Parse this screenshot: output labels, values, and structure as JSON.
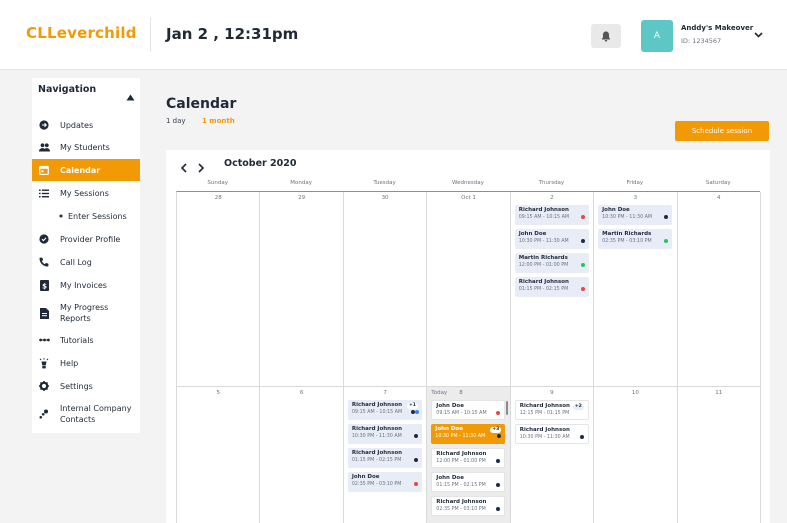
{
  "header": {
    "logo": "CLLeverchild",
    "datetime": "Jan 2 , 12:31pm",
    "user": {
      "avatar_letter": "A",
      "name": "Anddy's Makeover",
      "id_label": "ID: 1234567"
    }
  },
  "sidebar": {
    "title": "Navigation",
    "items": [
      {
        "label": "Updates",
        "icon": "arrow-circle-icon"
      },
      {
        "label": "My Students",
        "icon": "users-icon"
      },
      {
        "label": "Calendar",
        "icon": "calendar-icon"
      },
      {
        "label": "My Sessions",
        "icon": "list-icon"
      },
      {
        "label": "Enter Sessions",
        "icon": "bullet-icon"
      },
      {
        "label": "Provider Profile",
        "icon": "check-circle-icon"
      },
      {
        "label": "Call Log",
        "icon": "phone-icon"
      },
      {
        "label": "My Invoices",
        "icon": "dollar-icon"
      },
      {
        "label": "My Progress Reports",
        "icon": "document-icon"
      },
      {
        "label": "Tutorials",
        "icon": "dots-icon"
      },
      {
        "label": "Help",
        "icon": "lightbulb-icon"
      },
      {
        "label": "Settings",
        "icon": "gear-icon"
      },
      {
        "label": "Internal Company Contacts",
        "icon": "contacts-icon"
      }
    ]
  },
  "main": {
    "title": "Calendar",
    "views": {
      "day": "1 day",
      "month": "1 month"
    },
    "schedule_button": "Schedule session",
    "month_label": "October 2020",
    "today_label": "Today",
    "weekdays": [
      "Sunday",
      "Monday",
      "Tuesday",
      "Wednesday",
      "Thursday",
      "Friday",
      "Saturday"
    ],
    "week1": [
      "28",
      "29",
      "30",
      "Oct 1",
      "2",
      "3",
      "4"
    ],
    "week2": [
      "5",
      "6",
      "7",
      "8",
      "9",
      "10",
      "11"
    ],
    "events": {
      "thu2": [
        {
          "name": "Richard Johnson",
          "time": "09:15 AM - 10:15 AM",
          "dot": "#ef4444"
        },
        {
          "name": "John Doe",
          "time": "10:30 PM - 11:30 AM",
          "dot": "#1e2a4a"
        },
        {
          "name": "Martin Richards",
          "time": "12:00 PM - 01:00 PM",
          "dot": "#22c55e"
        },
        {
          "name": "Richard Johnson",
          "time": "01:15 PM - 02:15 PM",
          "dot": "#ef4444"
        }
      ],
      "fri3": [
        {
          "name": "John Doe",
          "time": "10:30 PM - 11:30 AM",
          "dot": "#1e2a4a"
        },
        {
          "name": "Martin Richards",
          "time": "02:35 PM - 03:10 PM",
          "dot": "#22c55e"
        }
      ],
      "tue7": [
        {
          "name": "Richard Johnson",
          "time": "09:15 AM - 10:15 AM",
          "badge": "+1"
        },
        {
          "name": "Richard Johnson",
          "time": "10:30 PM - 11:30 AM",
          "dot": "#1e2a4a"
        },
        {
          "name": "Richard Johnson",
          "time": "01:15 PM - 02:15 PM",
          "dot": "#1e2a4a"
        },
        {
          "name": "John Doe",
          "time": "02:35 PM - 03:10 PM",
          "dot": "#ef4444"
        }
      ],
      "wed8": [
        {
          "name": "John Doe",
          "time": "09:15 AM - 10:15 AM",
          "dot": "#ef4444"
        },
        {
          "name": "John Doe",
          "time": "10:30 PM - 11:30 AM",
          "badge": "+3"
        },
        {
          "name": "Richard Johnson",
          "time": "12:00 PM - 01:00 PM",
          "dot": "#1e2a4a"
        },
        {
          "name": "John Doe",
          "time": "01:15 PM - 02:15 PM",
          "dot": "#1e2a4a"
        },
        {
          "name": "Richard Johnson",
          "time": "02:35 PM - 03:10 PM",
          "dot": "#1e2a4a"
        }
      ],
      "thu9": [
        {
          "name": "Richard Johnson",
          "time": "12:15 PM - 01:15 PM",
          "badge": "+2"
        },
        {
          "name": "Richard Johnson",
          "time": "10:30 PM - 11:30 AM",
          "dot": "#1e2a4a"
        }
      ]
    }
  }
}
